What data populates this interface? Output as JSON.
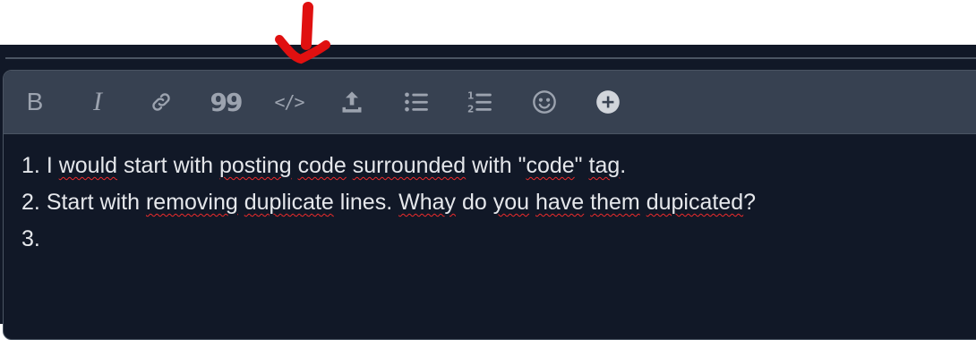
{
  "toolbar": {
    "bold_label": "B",
    "italic_label": "I",
    "blockquote_label": "99",
    "code_label": "</>",
    "icons": [
      "bold-icon",
      "italic-icon",
      "link-icon",
      "blockquote-icon",
      "code-icon",
      "upload-icon",
      "bullet-list-icon",
      "numbered-list-icon",
      "emoji-icon",
      "add-icon"
    ]
  },
  "editor": {
    "lines": [
      {
        "number": "1.",
        "segments": [
          "I",
          "would",
          "start with",
          "posting",
          "code",
          "surrounded",
          "with \"",
          "code",
          "\"",
          "tag",
          "."
        ]
      },
      {
        "number": "2.",
        "segments": [
          "Start with",
          "removing",
          "duplicate",
          "lines.",
          "Whay",
          "do",
          "you",
          "have",
          "them",
          "dupicated",
          "?"
        ]
      },
      {
        "number": "3.",
        "segments": []
      }
    ]
  },
  "colors": {
    "background": "#111827",
    "toolbar": "#374151",
    "icon": "#9ca3af",
    "text": "#e5e7eb",
    "spellcheck": "#ef2b2b",
    "annotation": "#e01010"
  }
}
